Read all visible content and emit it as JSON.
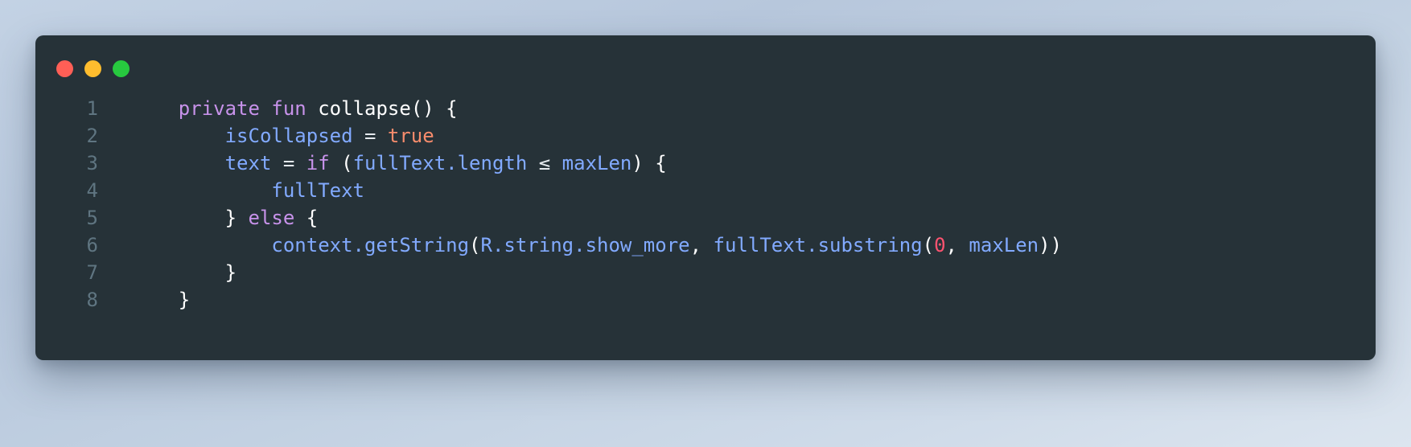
{
  "window": {
    "traffic_lights": [
      {
        "name": "close-button",
        "color": "#ff5f56"
      },
      {
        "name": "minimize-button",
        "color": "#ffbd2e"
      },
      {
        "name": "maximize-button",
        "color": "#27c93f"
      }
    ],
    "background_color": "#263238",
    "page_background": "#c3d2e4"
  },
  "editor": {
    "language": "kotlin",
    "line_numbers": [
      "1",
      "2",
      "3",
      "4",
      "5",
      "6",
      "7",
      "8"
    ],
    "plain_text": [
      "    private fun collapse() {",
      "        isCollapsed = true",
      "        text = if (fullText.length ≤ maxLen) {",
      "            fullText",
      "        } else {",
      "            context.getString(R.string.show_more, fullText.substring(0, maxLen))",
      "        }",
      "    }"
    ],
    "lines": [
      {
        "number": "1",
        "tokens": [
          {
            "text": "    ",
            "cls": "t-plain"
          },
          {
            "text": "private",
            "cls": "t-kw"
          },
          {
            "text": " ",
            "cls": "t-plain"
          },
          {
            "text": "fun",
            "cls": "t-kw"
          },
          {
            "text": " ",
            "cls": "t-plain"
          },
          {
            "text": "collapse",
            "cls": "t-pn"
          },
          {
            "text": "() {",
            "cls": "t-pn"
          }
        ]
      },
      {
        "number": "2",
        "tokens": [
          {
            "text": "        ",
            "cls": "t-plain"
          },
          {
            "text": "isCollapsed",
            "cls": "t-id"
          },
          {
            "text": " ",
            "cls": "t-plain"
          },
          {
            "text": "=",
            "cls": "t-op"
          },
          {
            "text": " ",
            "cls": "t-plain"
          },
          {
            "text": "true",
            "cls": "t-bool"
          }
        ]
      },
      {
        "number": "3",
        "tokens": [
          {
            "text": "        ",
            "cls": "t-plain"
          },
          {
            "text": "text",
            "cls": "t-id"
          },
          {
            "text": " ",
            "cls": "t-plain"
          },
          {
            "text": "=",
            "cls": "t-op"
          },
          {
            "text": " ",
            "cls": "t-plain"
          },
          {
            "text": "if",
            "cls": "t-kw"
          },
          {
            "text": " ",
            "cls": "t-plain"
          },
          {
            "text": "(",
            "cls": "t-pn"
          },
          {
            "text": "fullText",
            "cls": "t-id"
          },
          {
            "text": ".",
            "cls": "t-id"
          },
          {
            "text": "length",
            "cls": "t-id"
          },
          {
            "text": " ",
            "cls": "t-plain"
          },
          {
            "text": "≤",
            "cls": "t-op"
          },
          {
            "text": " ",
            "cls": "t-plain"
          },
          {
            "text": "maxLen",
            "cls": "t-id"
          },
          {
            "text": ") {",
            "cls": "t-pn"
          }
        ]
      },
      {
        "number": "4",
        "tokens": [
          {
            "text": "            ",
            "cls": "t-plain"
          },
          {
            "text": "fullText",
            "cls": "t-id"
          }
        ]
      },
      {
        "number": "5",
        "tokens": [
          {
            "text": "        ",
            "cls": "t-plain"
          },
          {
            "text": "}",
            "cls": "t-pn"
          },
          {
            "text": " ",
            "cls": "t-plain"
          },
          {
            "text": "else",
            "cls": "t-kw"
          },
          {
            "text": " ",
            "cls": "t-plain"
          },
          {
            "text": "{",
            "cls": "t-pn"
          }
        ]
      },
      {
        "number": "6",
        "tokens": [
          {
            "text": "            ",
            "cls": "t-plain"
          },
          {
            "text": "context",
            "cls": "t-id"
          },
          {
            "text": ".",
            "cls": "t-id"
          },
          {
            "text": "getString",
            "cls": "t-id"
          },
          {
            "text": "(",
            "cls": "t-pn"
          },
          {
            "text": "R",
            "cls": "t-id"
          },
          {
            "text": ".",
            "cls": "t-id"
          },
          {
            "text": "string",
            "cls": "t-id"
          },
          {
            "text": ".",
            "cls": "t-id"
          },
          {
            "text": "show_more",
            "cls": "t-id"
          },
          {
            "text": ",",
            "cls": "t-pn"
          },
          {
            "text": " ",
            "cls": "t-plain"
          },
          {
            "text": "fullText",
            "cls": "t-id"
          },
          {
            "text": ".",
            "cls": "t-id"
          },
          {
            "text": "substring",
            "cls": "t-id"
          },
          {
            "text": "(",
            "cls": "t-pn"
          },
          {
            "text": "0",
            "cls": "t-num"
          },
          {
            "text": ",",
            "cls": "t-pn"
          },
          {
            "text": " ",
            "cls": "t-plain"
          },
          {
            "text": "maxLen",
            "cls": "t-id"
          },
          {
            "text": "))",
            "cls": "t-pn"
          }
        ]
      },
      {
        "number": "7",
        "tokens": [
          {
            "text": "        ",
            "cls": "t-plain"
          },
          {
            "text": "}",
            "cls": "t-pn"
          }
        ]
      },
      {
        "number": "8",
        "tokens": [
          {
            "text": "    ",
            "cls": "t-plain"
          },
          {
            "text": "}",
            "cls": "t-pn"
          }
        ]
      }
    ]
  }
}
